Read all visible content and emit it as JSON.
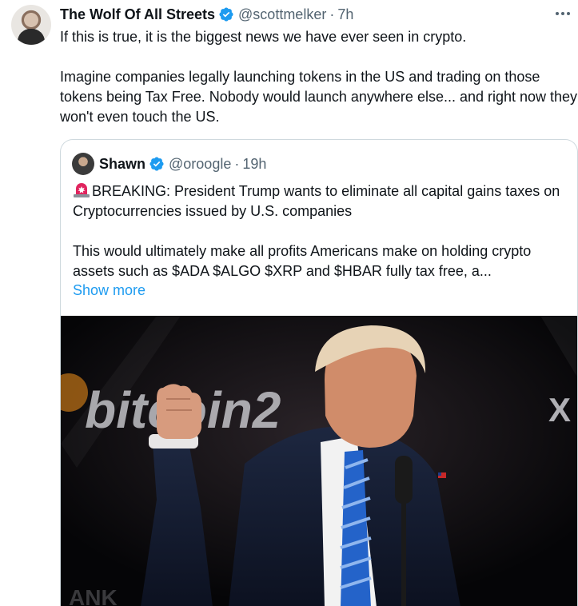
{
  "author": {
    "name": "The Wolf Of All Streets",
    "handle": "@scottmelker",
    "separator": "·",
    "time": "7h"
  },
  "tweet": {
    "text": "If this is true, it is the biggest news we have ever seen in crypto.\n\nImagine companies legally launching tokens in the US and trading on those tokens being Tax Free. Nobody would launch anywhere else... and right now they won't even touch the US."
  },
  "quote": {
    "name": "Shawn",
    "handle": "@oroogle",
    "separator": "·",
    "time": "19h",
    "text": "BREAKING: President Trump wants to eliminate all capital gains taxes on Cryptocurrencies issued by U.S. companies\n\nThis would ultimately make all profits Americans make on holding crypto assets such as $ADA $ALGO $XRP and $HBAR fully tax free, a...",
    "show_more": "Show more",
    "emoji": "siren-emoji"
  },
  "photo": {
    "sign_text": "bitcoin2",
    "sign_x": "X",
    "bottom_text": "ANK"
  },
  "icons": {
    "verified": "verified-badge-icon",
    "more": "more-options-icon"
  },
  "colors": {
    "verified": "#1d9bf0",
    "link": "#1d9bf0",
    "secondary_text": "#536471",
    "border": "#cfd9de"
  }
}
